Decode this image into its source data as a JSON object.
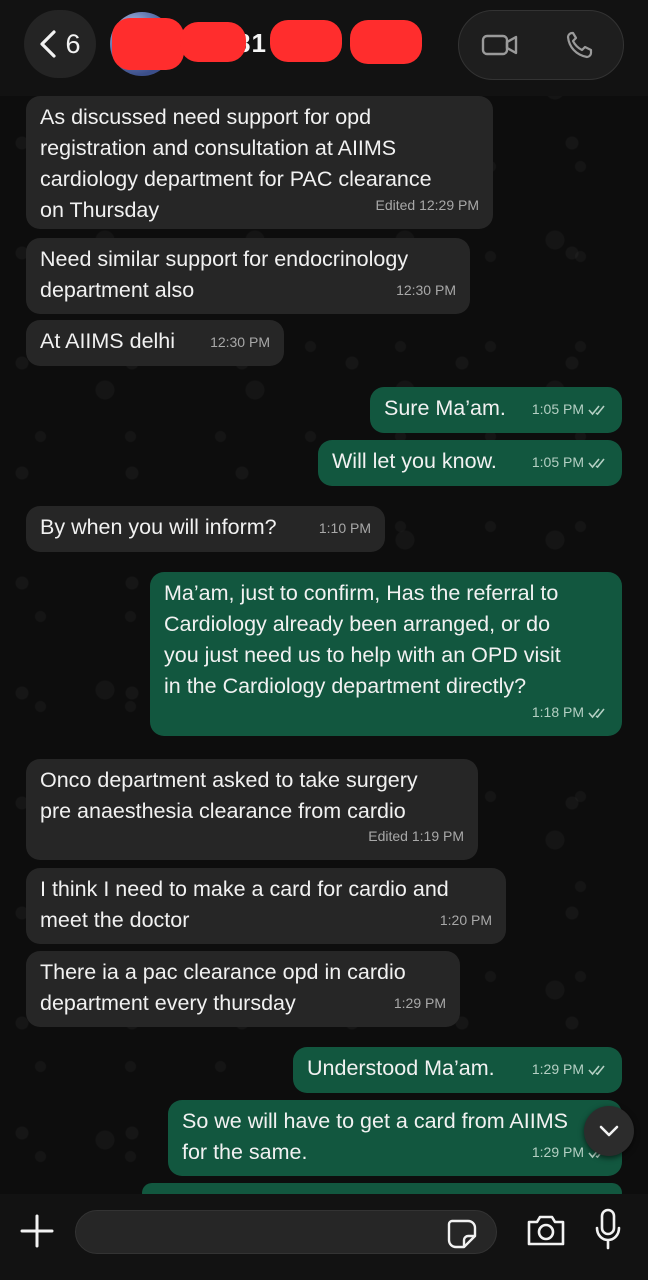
{
  "header": {
    "back_count": "6",
    "contact_name": "81   73",
    "icons": [
      "chevron-left-icon",
      "video-call-icon",
      "phone-icon"
    ]
  },
  "messages": [
    {
      "direction": "in",
      "text": "As discussed need support for opd\nregistration and consultation at AIIMS\ncardiology department for PAC clearance\non Thursday",
      "time": "Edited 12:29 PM"
    },
    {
      "direction": "in",
      "text": "Need similar support for endocrinology\ndepartment also",
      "time": "12:30 PM"
    },
    {
      "direction": "in",
      "text": "At AIIMS delhi",
      "time": "12:30 PM"
    },
    {
      "direction": "out",
      "text": "Sure Ma’am.",
      "time": "1:05 PM",
      "status": "read"
    },
    {
      "direction": "out",
      "text": "Will let you know.",
      "time": "1:05 PM",
      "status": "read"
    },
    {
      "direction": "in",
      "text": "By when you will inform?",
      "time": "1:10 PM"
    },
    {
      "direction": "out",
      "text": "Ma’am, just to confirm, Has the referral to\nCardiology already been arranged, or do\nyou just need us to help with an OPD visit\nin the Cardiology department directly?",
      "time": "1:18 PM",
      "status": "read"
    },
    {
      "direction": "in",
      "text": "Onco department asked to take surgery\npre anaesthesia clearance from cardio",
      "time": "Edited 1:19 PM"
    },
    {
      "direction": "in",
      "text": "I think I need to make a card for cardio and\nmeet the doctor",
      "time": "1:20 PM"
    },
    {
      "direction": "in",
      "text": "There ia a pac clearance opd in cardio\ndepartment every thursday",
      "time": "1:29 PM"
    },
    {
      "direction": "out",
      "text": "Understood Ma’am.",
      "time": "1:29 PM",
      "status": "read"
    },
    {
      "direction": "out",
      "text": "So we will have to get a card from AIIMS\nfor the same.",
      "time": "1:29 PM",
      "status": "read"
    }
  ],
  "input": {
    "placeholder": "",
    "icons": [
      "plus-icon",
      "sticker-icon",
      "camera-icon",
      "microphone-icon"
    ]
  },
  "colors": {
    "incoming_bubble": "#262626",
    "outgoing_bubble": "#12573f",
    "background": "#0d0d0d"
  }
}
